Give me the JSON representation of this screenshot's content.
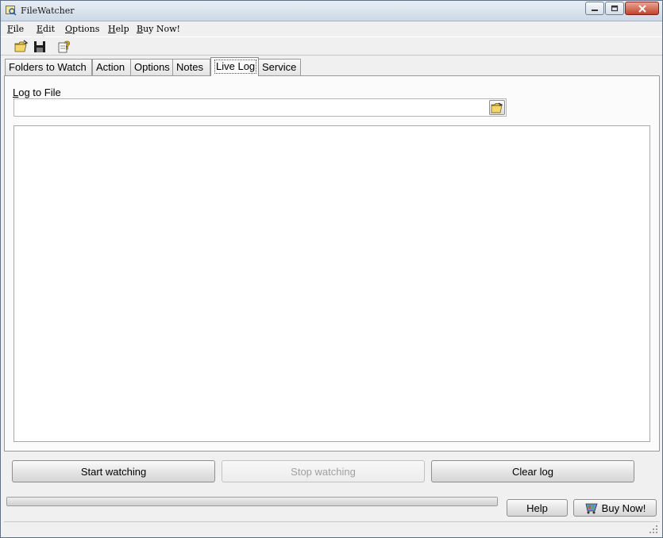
{
  "window": {
    "title": "FileWatcher"
  },
  "menu": [
    {
      "label": "File",
      "key": "F",
      "rest": "ile"
    },
    {
      "label": "Edit",
      "key": "E",
      "rest": "dit"
    },
    {
      "label": "Options",
      "key": "O",
      "rest": "ptions"
    },
    {
      "label": "Help",
      "key": "H",
      "rest": "elp"
    },
    {
      "label": "Buy Now!",
      "key": "B",
      "rest": "uy Now!"
    }
  ],
  "toolbar": {
    "icons": [
      "open-folder-icon",
      "save-icon",
      "help-icon"
    ]
  },
  "tabs": [
    {
      "label": "Folders to Watch",
      "active": false
    },
    {
      "label": "Action",
      "active": false
    },
    {
      "label": "Options",
      "active": false
    },
    {
      "label": "Notes",
      "active": false
    },
    {
      "label": "Live Log",
      "active": true
    },
    {
      "label": "Service",
      "active": false
    }
  ],
  "live_log": {
    "log_to_file_key": "L",
    "log_to_file_rest": "og to File",
    "log_file_value": "",
    "log_content": ""
  },
  "buttons": {
    "start": "Start watching",
    "stop": "Stop watching",
    "clear": "Clear log",
    "help": "Help",
    "buy": "Buy Now!"
  },
  "progress": {
    "value": 1.0
  },
  "colors": {
    "titlebar": "#cdd9e6",
    "close_button": "#c1432c",
    "window_bg": "#f0f0f0"
  }
}
